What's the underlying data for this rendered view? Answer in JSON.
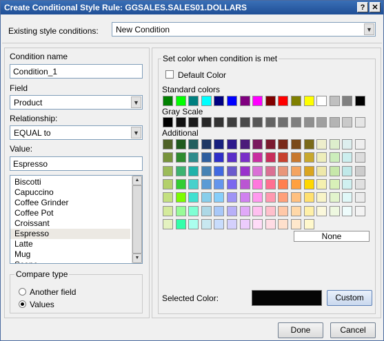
{
  "window": {
    "title": "Create Conditional Style Rule: GGSALES.SALES01.DOLLARS",
    "help_glyph": "?",
    "close_glyph": "✕"
  },
  "existing": {
    "label": "Existing style conditions:",
    "value": "New Condition"
  },
  "condition": {
    "name_label": "Condition name",
    "name_value": "Condition_1",
    "field_label": "Field",
    "field_value": "Product",
    "relationship_label": "Relationship:",
    "relationship_value": "EQUAL to",
    "value_label": "Value:",
    "value_value": "Espresso",
    "values": [
      "Biscotti",
      "Capuccino",
      "Coffee Grinder",
      "Coffee Pot",
      "Croissant",
      "Espresso",
      "Latte",
      "Mug",
      "Scone"
    ],
    "selected_index": 5
  },
  "compare": {
    "legend": "Compare type",
    "options": [
      "Another field",
      "Values"
    ],
    "selected_index": 1
  },
  "colors": {
    "legend": "Set color when condition is met",
    "default_label": "Default Color",
    "standard_label": "Standard colors",
    "gray_label": "Gray Scale",
    "additional_label": "Additional",
    "none_label": "None",
    "selected_label": "Selected Color:",
    "selected_value": "#050505",
    "custom_label": "Custom",
    "standard": [
      "#008000",
      "#00ff00",
      "#008080",
      "#00ffff",
      "#000080",
      "#0000ff",
      "#800080",
      "#ff00ff",
      "#800000",
      "#ff0000",
      "#808000",
      "#ffff00",
      "#ffffff",
      "#c0c0c0",
      "#808080",
      "#000000"
    ],
    "gray": [
      "#000000",
      "#111111",
      "#1c1c1c",
      "#282828",
      "#333333",
      "#3f3f3f",
      "#4b4b4b",
      "#575757",
      "#636363",
      "#707070",
      "#7f7f7f",
      "#8f8f8f",
      "#a0a0a0",
      "#b4b4b4",
      "#cacaca",
      "#e5e5e5"
    ],
    "additional": [
      [
        "#4f6228",
        "#1e5a1e",
        "#215e5e",
        "#1f3864",
        "#17207e",
        "#2e1a8c",
        "#4b1a7a",
        "#7a1a5e",
        "#7a1a2e",
        "#7a2a1a",
        "#7a4a1a",
        "#7a6a1a",
        "#eeeecc",
        "#ddeecc",
        "#ddeeee",
        "#eeeeee"
      ],
      [
        "#77933c",
        "#2e8b2e",
        "#2e8b8b",
        "#2e5e9e",
        "#2e2ec8",
        "#5a2ec8",
        "#7a2ec8",
        "#c82ea0",
        "#c82e5a",
        "#c8402e",
        "#c8782e",
        "#c8a82e",
        "#eeeebb",
        "#cceebb",
        "#cceeee",
        "#dddddd"
      ],
      [
        "#9bbb59",
        "#3cb371",
        "#20b2aa",
        "#4682b4",
        "#4169e1",
        "#6a5acd",
        "#9932cc",
        "#da70d6",
        "#db7093",
        "#e9967a",
        "#f4a460",
        "#daa520",
        "#eee8aa",
        "#c7e8aa",
        "#c0e8e8",
        "#cccccc"
      ],
      [
        "#b3d06b",
        "#32cd32",
        "#48d1cc",
        "#5b9bd5",
        "#6495ed",
        "#7b68ee",
        "#ba55d3",
        "#ff77dd",
        "#ff6f91",
        "#ff7f50",
        "#ffa040",
        "#ffd700",
        "#f5f0b0",
        "#d8f0b8",
        "#d0f0f0",
        "#e0e0e0"
      ],
      [
        "#c4e080",
        "#7cfc00",
        "#40e0d0",
        "#87ceeb",
        "#87cefa",
        "#9f94f5",
        "#d080f0",
        "#ff99ee",
        "#ff99b0",
        "#ffa07a",
        "#ffc080",
        "#ffe070",
        "#f8f4c8",
        "#e2f4cc",
        "#e0f8f8",
        "#ebebeb"
      ],
      [
        "#d4ea9c",
        "#98fb98",
        "#7fffd4",
        "#add8e6",
        "#a8c8f8",
        "#b8b0f8",
        "#e0a8f8",
        "#ffc0f0",
        "#ffc0cc",
        "#ffc8a8",
        "#ffd8a8",
        "#fff0a8",
        "#fbf8dc",
        "#eef8e0",
        "#eefcfc",
        "#f3f3f3"
      ],
      [
        "#e4f2c0",
        "#33ffaa",
        "#aaffee",
        "#c8e8f0",
        "#c8dcfc",
        "#d4d0fc",
        "#ecccfc",
        "#ffdcf8",
        "#ffdce4",
        "#ffe0cc",
        "#ffe8cc",
        "#fff8cc"
      ]
    ]
  },
  "footer": {
    "done_label": "Done",
    "cancel_label": "Cancel"
  }
}
